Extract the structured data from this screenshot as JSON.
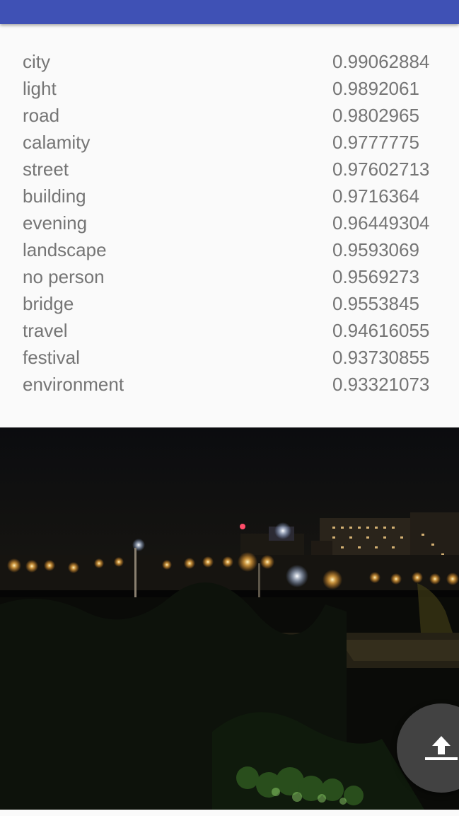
{
  "app_bar": {
    "color": "#3f51b5"
  },
  "results": [
    {
      "label": "city",
      "score": "0.99062884"
    },
    {
      "label": "light",
      "score": "0.9892061"
    },
    {
      "label": "road",
      "score": "0.9802965"
    },
    {
      "label": "calamity",
      "score": "0.9777775"
    },
    {
      "label": "street",
      "score": "0.97602713"
    },
    {
      "label": "building",
      "score": "0.9716364"
    },
    {
      "label": "evening",
      "score": "0.96449304"
    },
    {
      "label": "landscape",
      "score": "0.9593069"
    },
    {
      "label": "no person",
      "score": "0.9569273"
    },
    {
      "label": "bridge",
      "score": "0.9553845"
    },
    {
      "label": "travel",
      "score": "0.94616055"
    },
    {
      "label": "festival",
      "score": "0.93730855"
    },
    {
      "label": "environment",
      "score": "0.93321073"
    }
  ],
  "photo": {
    "description_icon": "night-city-photo"
  },
  "fab": {
    "icon": "upload-icon",
    "color": "#424242"
  }
}
